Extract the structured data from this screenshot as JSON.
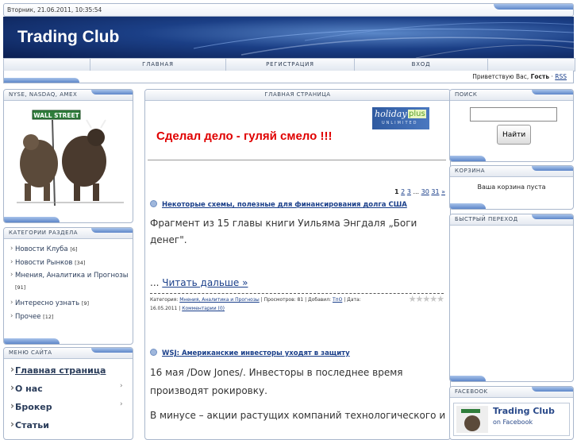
{
  "top": {
    "datetime": "Вторник, 21.06.2011, 10:35:54",
    "site_title": "Trading Club"
  },
  "nav": [
    "ГЛАВНАЯ",
    "РЕГИСТРАЦИЯ",
    "ВХОД"
  ],
  "greet": {
    "prefix": "Приветствую Вас,",
    "user": "Гость",
    "rss": "RSS"
  },
  "left": {
    "markets_title": "NYSE, NASDAQ, AMEX",
    "wall_street": "WALL STREET",
    "categories_title": "КАТЕГОРИИ РАЗДЕЛА",
    "categories": [
      {
        "name": "Новости Клуба",
        "count": "[6]"
      },
      {
        "name": "Новости Рынков",
        "count": "[34]"
      },
      {
        "name": "Мнения, Аналитика и Прогнозы",
        "count": "[91]"
      },
      {
        "name": "Интересно узнать",
        "count": "[9]"
      },
      {
        "name": "Прочее",
        "count": "[12]"
      }
    ],
    "menu_title": "МЕНЮ САЙТА",
    "menu": [
      "Главная страница",
      "О нас",
      "Брокер",
      "Статьи"
    ]
  },
  "center": {
    "title": "ГЛАВНАЯ СТРАНИЦА",
    "slogan": "Сделал дело - гуляй смело !!!",
    "banner": {
      "word": "holiday",
      "plus": "plus",
      "sub": "UNLIMITED"
    },
    "pager": {
      "current": "1",
      "p2": "2",
      "p3": "3",
      "ellipsis": "...",
      "p30": "30",
      "p31": "31",
      "next": "»"
    },
    "articles": [
      {
        "title": "Некоторые схемы, полезные для финансирования долга США",
        "lead": "Фрагмент из 15 главы книги Уильяма Энгдаля „Боги денег\".",
        "more_prefix": "...",
        "more": "Читать дальше »",
        "meta_cat_label": "Категория:",
        "meta_cat": "Мнения, Аналитика и Прогнозы",
        "meta_views": "| Просмотров: 81 | Добавил:",
        "meta_author": "ТпО",
        "meta_date_label": "| Дата:",
        "meta_date": "16.05.2011 |",
        "meta_comments": "Комментарии (0)"
      },
      {
        "title": "WSJ: Американские инвесторы уходят в защиту",
        "lead": "16 мая /Dow Jones/. Инвесторы в последнее время производят рокировку.",
        "cont": "В минусе – акции растущих компаний технологического и"
      }
    ]
  },
  "right": {
    "search_title": "ПОИСК",
    "search_button": "Найти",
    "search_value": "",
    "cart_title": "КОРЗИНА",
    "cart_text": "Ваша корзина пуста",
    "jump_title": "БЫСТРЫЙ ПЕРЕХОД",
    "fb_title": "FACEBOOK",
    "fb_name": "Trading Club",
    "fb_sub": "on Facebook"
  }
}
